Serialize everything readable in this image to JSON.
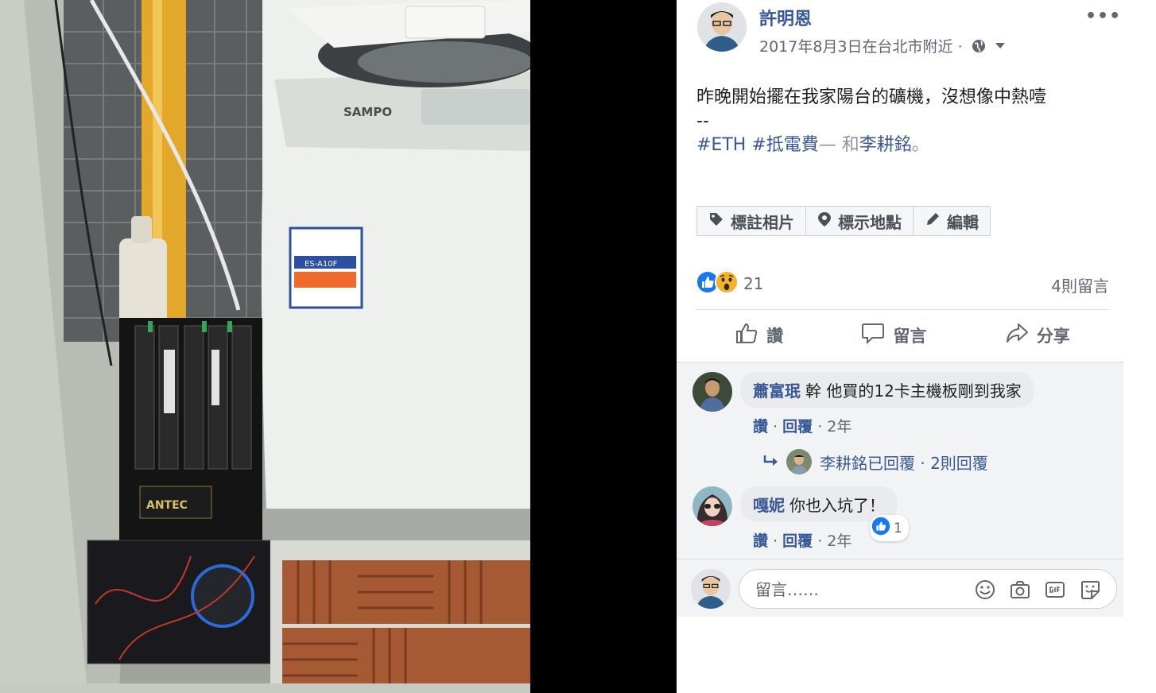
{
  "post": {
    "author": "許明恩",
    "meta": "2017年8月3日在台北市附近 ·",
    "text_line1": "昨晚開始擺在我家陽台的礦機，沒想像中熱噎",
    "text_line2": "--",
    "hashtag1": "#ETH",
    "hashtag2": "#抵電費",
    "with_prefix": "— 和",
    "with_person": "李耕銘",
    "period": "。"
  },
  "photo_actions": {
    "tag_label": "標註相片",
    "location_label": "標示地點",
    "edit_label": "編輯"
  },
  "reactions": {
    "count": "21",
    "comments_label": "4則留言"
  },
  "ufi": {
    "like": "讚",
    "comment": "留言",
    "share": "分享"
  },
  "comments": [
    {
      "name": "蕭富珉",
      "text": "幹 他買的12卡主機板剛到我家",
      "like": "讚",
      "reply": "回覆",
      "age": "2年"
    },
    {
      "name": "嘎妮",
      "text": "你也入坑了！",
      "like": "讚",
      "reply": "回覆",
      "age": "2年",
      "likes": "1"
    }
  ],
  "reply_summary": "李耕銘已回覆 · 2則回覆",
  "composer": {
    "placeholder": "留言……"
  },
  "photo_labels": {
    "brand": "SAMPO",
    "model": "ES-A10F",
    "psu": "ANTEC"
  },
  "colors": {
    "link": "#385898",
    "muted": "#606770",
    "like_blue": "#1877f2",
    "wow_yellow": "#f7b125"
  }
}
